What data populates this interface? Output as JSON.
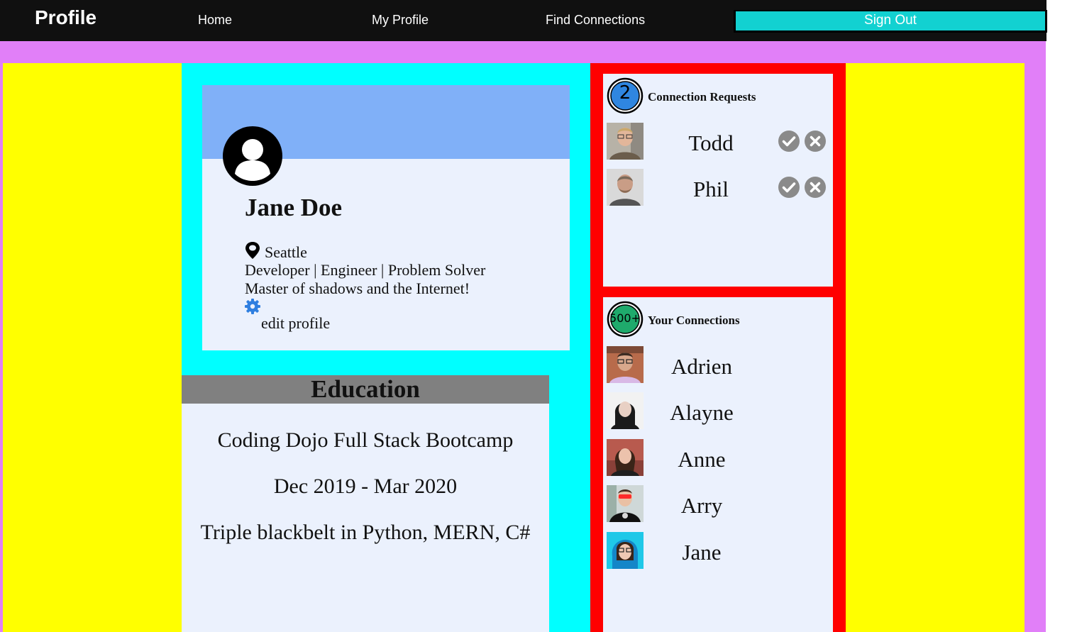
{
  "navbar": {
    "brand": "Profile",
    "links": [
      "Home",
      "My Profile",
      "Find Connections"
    ],
    "signout_label": "Sign Out"
  },
  "profile": {
    "name": "Jane Doe",
    "location": "Seattle",
    "tagline": "Developer | Engineer | Problem Solver",
    "bio": "Master of shadows and the Internet!",
    "edit_label": "edit profile"
  },
  "education": {
    "title": "Education",
    "school": "Coding Dojo Full Stack Bootcamp",
    "dates": "Dec 2019 - Mar 2020",
    "note": "Triple blackbelt in Python, MERN, C#"
  },
  "requests": {
    "count": "2",
    "title": "Connection Requests",
    "items": [
      {
        "name": "Todd"
      },
      {
        "name": "Phil"
      }
    ]
  },
  "connections": {
    "count": "500+",
    "title": "Your Connections",
    "items": [
      {
        "name": "Adrien"
      },
      {
        "name": "Alayne"
      },
      {
        "name": "Anne"
      },
      {
        "name": "Arry"
      },
      {
        "name": "Jane"
      }
    ]
  },
  "colors": {
    "navbar": "#101010",
    "signout": "#12d1d1",
    "outer": "#e17ff8",
    "side": "#ffff00",
    "center": "#00ffff",
    "right": "#ff0000",
    "card": "#ebf1fd",
    "banner": "#80b0f8",
    "edu_header": "#808080",
    "request_badge": "#2f86e0",
    "connections_badge": "#1faa6c"
  },
  "icons": {
    "avatar": "user-circle-icon",
    "location": "map-pin-icon",
    "edit": "gear-icon",
    "accept": "check-circle-icon",
    "decline": "x-circle-icon"
  }
}
